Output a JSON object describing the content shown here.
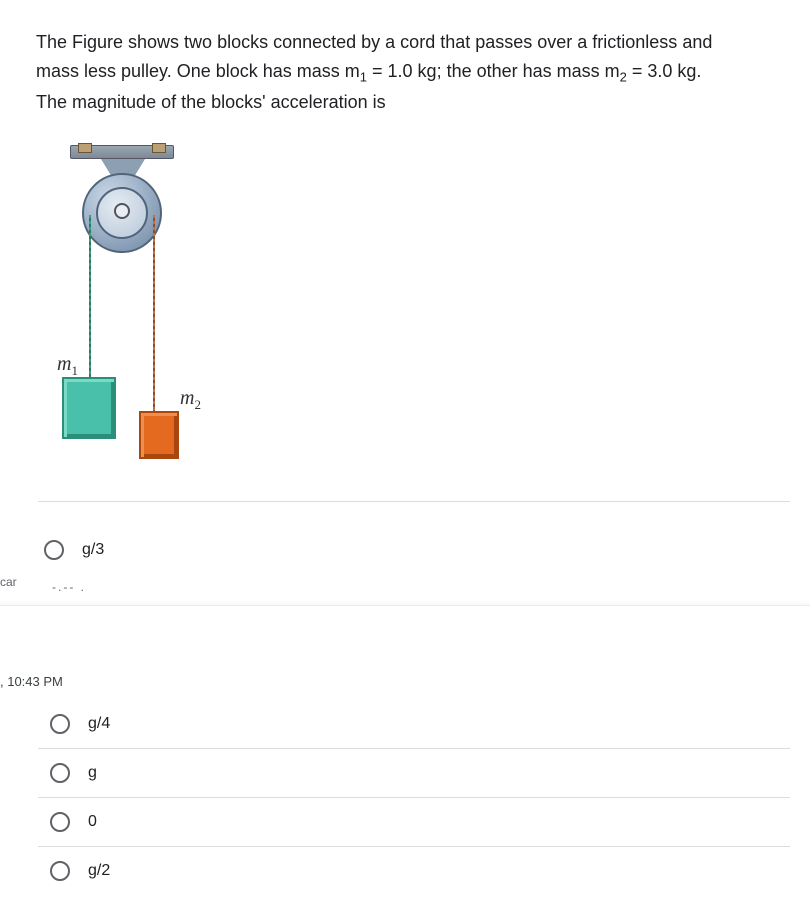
{
  "question": {
    "line1": "The Figure shows two blocks connected by a cord that passes over a frictionless and",
    "line2_a": "mass less pulley. One block has mass m",
    "line2_sub1": "1",
    "line2_b": " = 1.0 kg; the other has mass m",
    "line2_sub2": "2",
    "line2_c": " = 3.0 kg.",
    "line3": "The magnitude of the blocks' acceleration is"
  },
  "labels": {
    "m1_sym": "m",
    "m1_sub": "1",
    "m2_sym": "m",
    "m2_sub": "2"
  },
  "options": {
    "a": "g/3",
    "b": "g/4",
    "c": "g",
    "d": "0",
    "e": "g/2"
  },
  "fragments": {
    "car": "car",
    "timestamp": ", 10:43 PM",
    "dashes": "-.-- ."
  }
}
